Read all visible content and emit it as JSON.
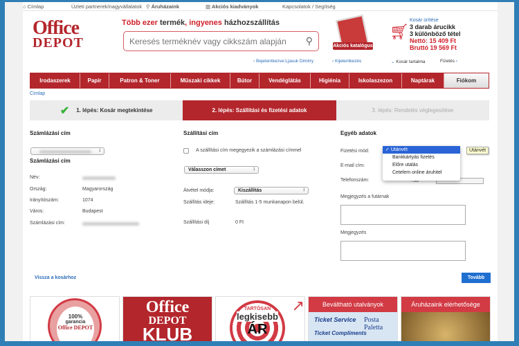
{
  "topnav": {
    "home": "Címlap",
    "partners": "Üzleti partnerek/nagyvállalatok",
    "stores": "Áruházaink",
    "catalogs": "Akciós kiadványok",
    "contact": "Kapcsolatok / Segítség"
  },
  "logo": {
    "line1": "Office",
    "line2": "DEPOT"
  },
  "tagline": {
    "p1": "Több ezer",
    "p2": " termék",
    "p3": ", ingyenes",
    "p4": " házhozszállítás"
  },
  "search": {
    "placeholder": "Keresés terméknév vagy cikkszám alapján"
  },
  "catalog": {
    "label": "Akciós katalógus"
  },
  "cart": {
    "empty": "Kosár ürítése",
    "items": "3 darab árucikk",
    "distinct": "3 különböző tétel",
    "net": "Nettó: 15 409 Ft",
    "gross": "Bruttó 19 569 Ft",
    "contents": "Kosár tartalma",
    "checkout": "Fizetés"
  },
  "user": {
    "logged_in": "Bejelentkezve:Ljasuk Dimitry",
    "logout": "Kijelentkezés"
  },
  "menu": [
    "Irodaszerek",
    "Papír",
    "Patron & Toner",
    "Műszaki cikkek",
    "Bútor",
    "Vendéglátás",
    "Higiénia",
    "Iskolaszezon",
    "Naptárak",
    "Fiókom"
  ],
  "breadcrumb": "Címlap",
  "steps": [
    "1. lépés: Kosár megtekintése",
    "2. lépés: Szállítási és fizetési adatok",
    "3. lépés: Rendelés véglegesítése"
  ],
  "billing": {
    "title": "Számlázási cím",
    "subtitle": "Számlázási cím",
    "labels": {
      "name": "Név:",
      "country": "Ország:",
      "zip": "Irányítószám:",
      "city": "Város:",
      "address": "Számlázási cím:"
    },
    "country": "Magyarország",
    "zip": "1074",
    "city": "Budapest"
  },
  "shipping": {
    "title": "Szállítási cím",
    "same_label": "A szállítási cím megegyezik a számlázási címmel",
    "choose": "Válasszon címet",
    "method_label": "Átvétel módja:",
    "method": "Kiszállítás",
    "time_label": "Szállítás ideje:",
    "time": "Szállítás 1-5 munkanapon belül.",
    "fee_label": "Szállítási díj",
    "fee": "0 Ft"
  },
  "other": {
    "title": "Egyéb adatok",
    "payment_label": "Fizetési mód:",
    "email_label": "E-mail cím:",
    "phone_label": "Telefonszám:",
    "phone_prefix": "+36",
    "courier_note_label": "Megjegyzés a futárnak",
    "note_label": "Megjegyzés",
    "payment_options": [
      "Utánvét",
      "Bankkártyás fizetés",
      "Előre utalás",
      "Cetelem online áruhitel"
    ],
    "tooltip": "Utánvét"
  },
  "actions": {
    "back": "Vissza a kosárhoz",
    "next": "Tovább"
  },
  "banners": {
    "guarantee": [
      "100%",
      "garancia",
      "Office DEPOT"
    ],
    "club": [
      "Office",
      "DEPOT",
      "KLUB"
    ],
    "price": [
      "TARTÓSAN",
      "legkisebb",
      "ÁR"
    ],
    "vouchers": "Beváltható utalványok",
    "voucher_logos": [
      "Ticket Service",
      "Posta Paletta",
      "Ticket Compliments"
    ],
    "stores": "Áruházaink elérhetősége"
  },
  "colors": {
    "brand_red": "#b3262c",
    "link_blue": "#2b6cb8",
    "button_blue": "#1f6fd0",
    "frame_blue": "#2f7fb6"
  }
}
